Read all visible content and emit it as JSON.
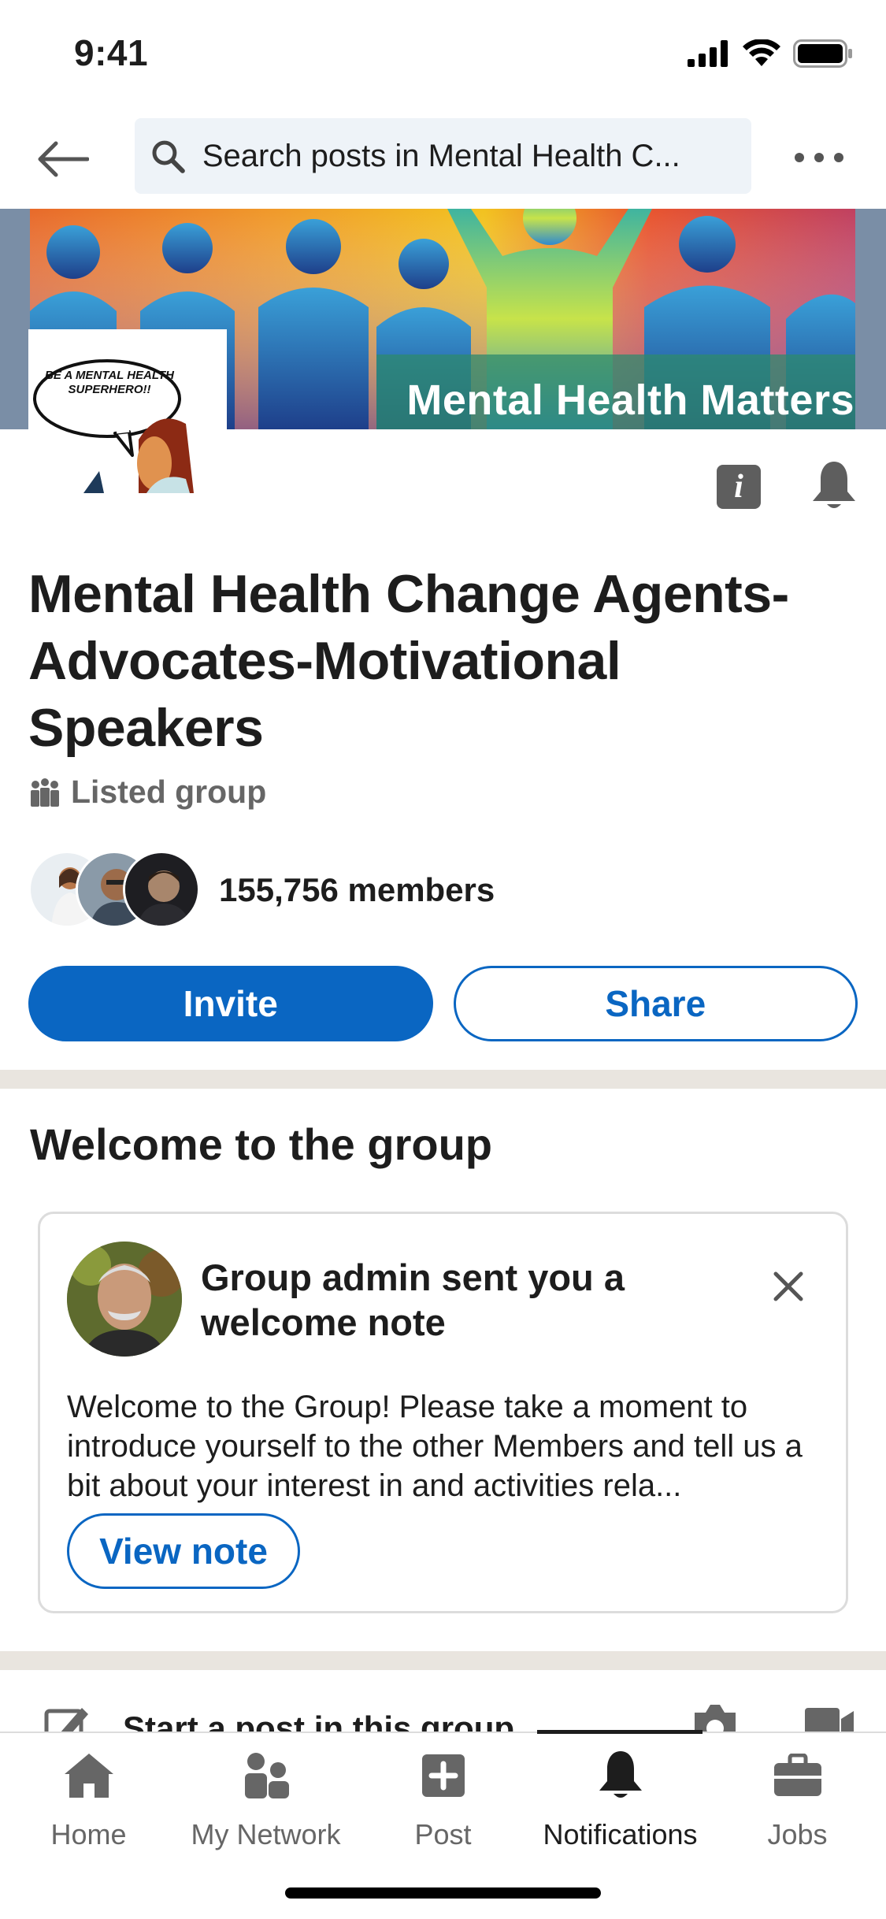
{
  "status_bar": {
    "time": "9:41"
  },
  "top_nav": {
    "search_text": "Search posts in Mental Health C..."
  },
  "banner": {
    "text": "Mental Health Matters",
    "logo_text": "BE A MENTAL HEALTH SUPERHERO!!"
  },
  "group": {
    "title": "Mental Health Change Agents-Advocates-Motivational Speakers",
    "type": "Listed group",
    "members": "155,756 members"
  },
  "actions": {
    "invite": "Invite",
    "share": "Share"
  },
  "welcome": {
    "heading": "Welcome to the group",
    "card_title": "Group admin sent you a welcome note",
    "card_body": "Welcome to the Group! Please take a moment to introduce yourself to the other Members and tell us a bit about your interest in and activities rela...",
    "view_note": "View note"
  },
  "composer": {
    "placeholder": "Start a post in this group"
  },
  "tabs": [
    {
      "label": "Home",
      "icon": "home-icon",
      "active": false
    },
    {
      "label": "My Network",
      "icon": "network-icon",
      "active": false
    },
    {
      "label": "Post",
      "icon": "post-icon",
      "active": false
    },
    {
      "label": "Notifications",
      "icon": "bell-icon",
      "active": true
    },
    {
      "label": "Jobs",
      "icon": "briefcase-icon",
      "active": false
    }
  ],
  "colors": {
    "accent": "#0a66c2",
    "divider": "#e9e5df",
    "search_bg": "#eef3f8"
  }
}
